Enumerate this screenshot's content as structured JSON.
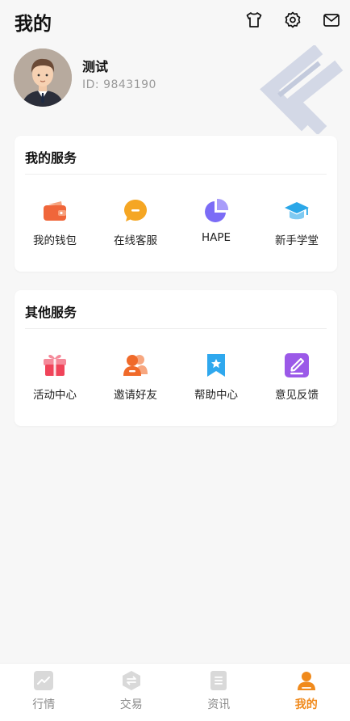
{
  "header": {
    "title": "我的",
    "icons": [
      "shirt-icon",
      "gear-icon",
      "mail-icon"
    ]
  },
  "profile": {
    "nickname": "测试",
    "id_text": "ID:  9843190"
  },
  "my_services": {
    "title": "我的服务",
    "items": [
      {
        "label": "我的钱包",
        "icon": "wallet-icon",
        "color": "#f0663a"
      },
      {
        "label": "在线客服",
        "icon": "chat-bubble-icon",
        "color": "#f5a623"
      },
      {
        "label": "HAPE",
        "icon": "pie-chart-icon",
        "color": "#7b6cf6"
      },
      {
        "label": "新手学堂",
        "icon": "graduation-cap-icon",
        "color": "#2aa7e8"
      }
    ]
  },
  "other_services": {
    "title": "其他服务",
    "items": [
      {
        "label": "活动中心",
        "icon": "gift-icon",
        "color": "#f0445a"
      },
      {
        "label": "邀请好友",
        "icon": "invite-users-icon",
        "color": "#f06a2a"
      },
      {
        "label": "帮助中心",
        "icon": "bookmark-star-icon",
        "color": "#2fa8ee"
      },
      {
        "label": "意见反馈",
        "icon": "edit-note-icon",
        "color": "#9b59e8"
      }
    ]
  },
  "tabbar": {
    "items": [
      {
        "label": "行情",
        "icon": "market-chart-icon",
        "active": false
      },
      {
        "label": "交易",
        "icon": "trade-exchange-icon",
        "active": false
      },
      {
        "label": "资讯",
        "icon": "news-doc-icon",
        "active": false
      },
      {
        "label": "我的",
        "icon": "user-icon",
        "active": true
      }
    ],
    "active_color": "#f08a1c"
  }
}
